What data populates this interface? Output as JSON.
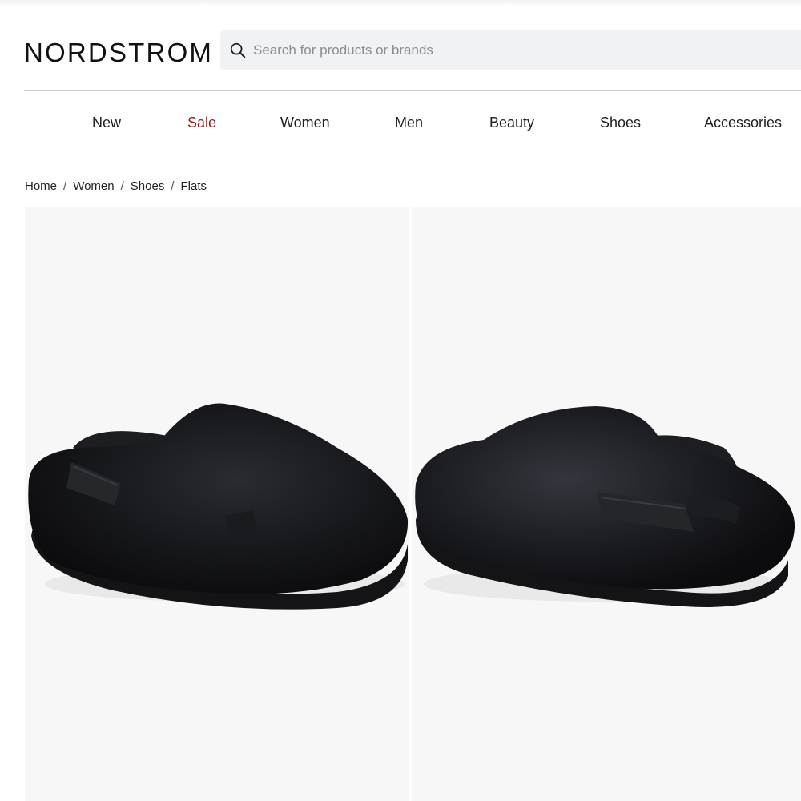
{
  "header": {
    "logo": "NORDSTROM",
    "search_placeholder": "Search for products or brands"
  },
  "nav": {
    "items": [
      {
        "label": "New",
        "highlight": false
      },
      {
        "label": "Sale",
        "highlight": true
      },
      {
        "label": "Women",
        "highlight": false
      },
      {
        "label": "Men",
        "highlight": false
      },
      {
        "label": "Beauty",
        "highlight": false
      },
      {
        "label": "Shoes",
        "highlight": false
      },
      {
        "label": "Accessories",
        "highlight": false
      }
    ],
    "sale_color": "#8f1b1b"
  },
  "breadcrumb": [
    "Home",
    "Women",
    "Shoes",
    "Flats"
  ],
  "gallery": {
    "images": [
      {
        "alt_icon": "black-faux-fur-slingback-slipper-side-view"
      },
      {
        "alt_icon": "black-faux-fur-slingback-slipper-opposite-view"
      }
    ]
  }
}
